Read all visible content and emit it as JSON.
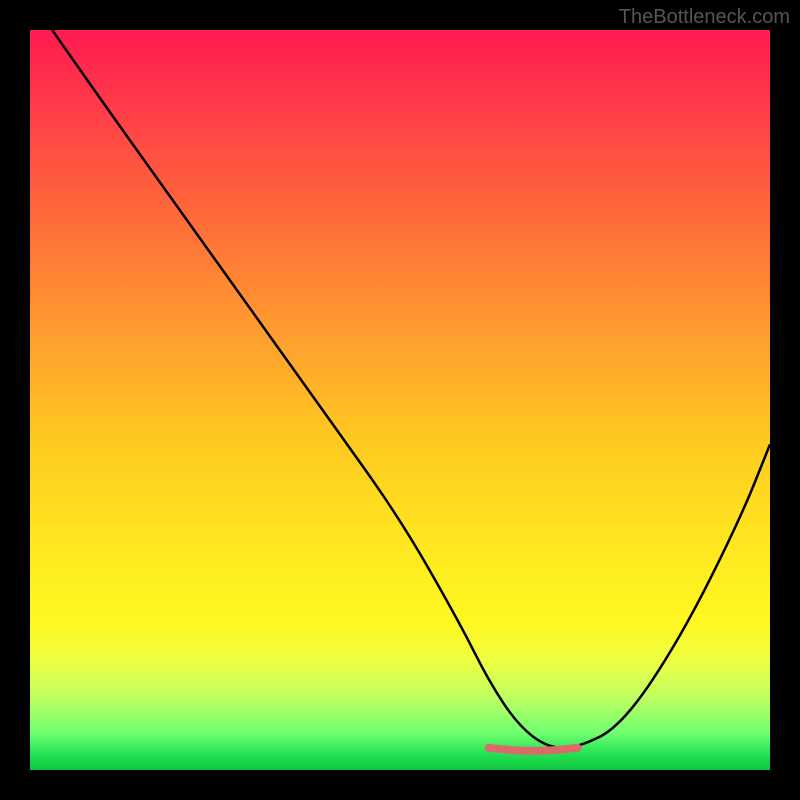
{
  "watermark": "TheBottleneck.com",
  "chart_data": {
    "type": "line",
    "title": "",
    "xlabel": "",
    "ylabel": "",
    "xlim": [
      0,
      100
    ],
    "ylim": [
      0,
      100
    ],
    "gradient_colors": {
      "top": "#ff1a50",
      "middle": "#ffe820",
      "bottom": "#10c840"
    },
    "series": [
      {
        "name": "bottleneck-curve",
        "color": "#000000",
        "x": [
          3,
          10,
          20,
          30,
          40,
          50,
          58,
          62,
          66,
          70,
          74,
          80,
          88,
          96,
          100
        ],
        "y": [
          100,
          90,
          76,
          62,
          48,
          34,
          20,
          12,
          6,
          3,
          3,
          6,
          18,
          34,
          44
        ]
      },
      {
        "name": "optimal-marker",
        "color": "#d96b6b",
        "type": "marker",
        "x": [
          62,
          74
        ],
        "y": [
          3,
          3
        ]
      }
    ]
  }
}
